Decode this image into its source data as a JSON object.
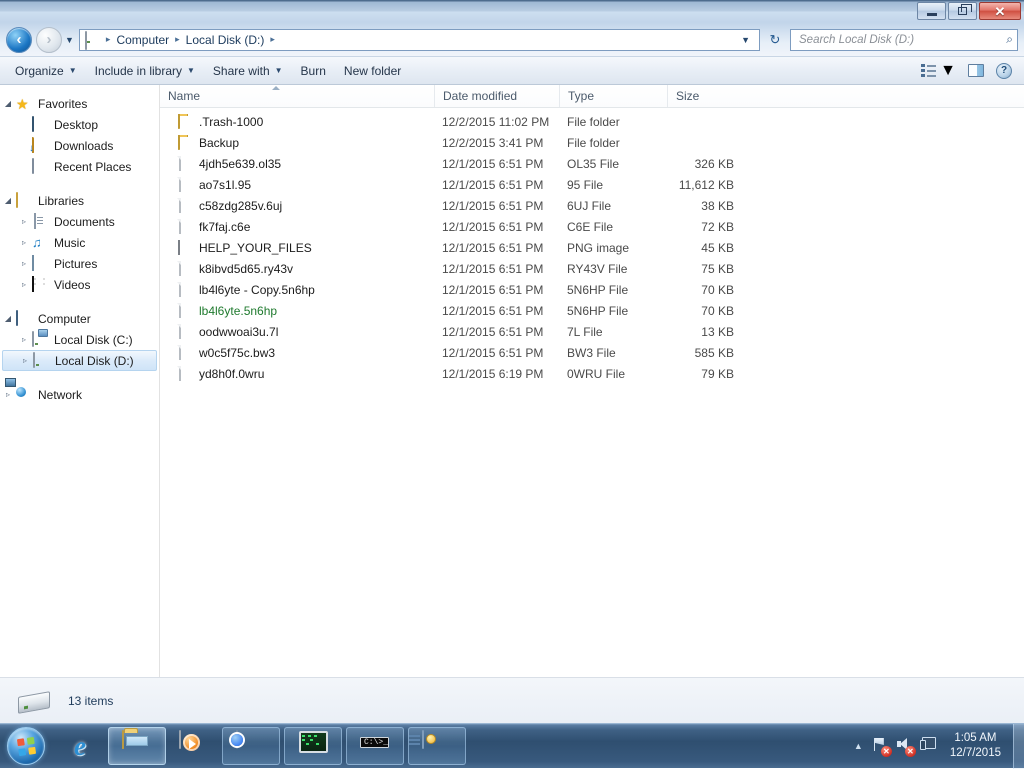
{
  "window": {
    "minimize_label": "Minimize",
    "restore_label": "Restore",
    "close_label": "Close"
  },
  "address_bar": {
    "back_label": "Back",
    "forward_label": "Forward",
    "history_label": "Recent pages",
    "crumbs": [
      "Computer",
      "Local Disk (D:)"
    ],
    "separator": "▸",
    "dropdown": "▼",
    "refresh_label": "Refresh",
    "refresh_icon": "↻"
  },
  "search": {
    "placeholder": "Search Local Disk (D:)",
    "icon": "⌕"
  },
  "toolbar": {
    "items": [
      {
        "label": "Organize",
        "caret": "▼"
      },
      {
        "label": "Include in library",
        "caret": "▼"
      },
      {
        "label": "Share with",
        "caret": "▼"
      },
      {
        "label": "Burn",
        "caret": ""
      },
      {
        "label": "New folder",
        "caret": ""
      }
    ],
    "view_caret": "▼",
    "view_label": "Change your view",
    "preview_label": "Show the preview pane",
    "help_label": "Get help",
    "help_glyph": "?"
  },
  "sidebar": {
    "groups": [
      {
        "header": {
          "label": "Favorites",
          "icon": "star-icon",
          "expander": "◢"
        },
        "items": [
          {
            "label": "Desktop",
            "icon": "desktop-icon",
            "expander": ""
          },
          {
            "label": "Downloads",
            "icon": "downloads-icon",
            "expander": ""
          },
          {
            "label": "Recent Places",
            "icon": "recent-places-icon",
            "expander": ""
          }
        ]
      },
      {
        "header": {
          "label": "Libraries",
          "icon": "libraries-icon",
          "expander": "◢"
        },
        "items": [
          {
            "label": "Documents",
            "icon": "documents-icon",
            "expander": "▹"
          },
          {
            "label": "Music",
            "icon": "music-icon",
            "expander": "▹"
          },
          {
            "label": "Pictures",
            "icon": "pictures-icon",
            "expander": "▹"
          },
          {
            "label": "Videos",
            "icon": "videos-icon",
            "expander": "▹"
          }
        ]
      },
      {
        "header": {
          "label": "Computer",
          "icon": "computer-icon",
          "expander": "◢"
        },
        "items": [
          {
            "label": "Local Disk (C:)",
            "icon": "system-drive-icon",
            "expander": "▹",
            "selected": false
          },
          {
            "label": "Local Disk (D:)",
            "icon": "drive-icon",
            "expander": "▹",
            "selected": true
          }
        ]
      },
      {
        "header": {
          "label": "Network",
          "icon": "network-icon",
          "expander": "▹"
        },
        "items": []
      }
    ]
  },
  "file_list": {
    "columns": [
      {
        "label": "Name",
        "sorted": "asc"
      },
      {
        "label": "Date modified",
        "sorted": ""
      },
      {
        "label": "Type",
        "sorted": ""
      },
      {
        "label": "Size",
        "sorted": ""
      }
    ],
    "rows": [
      {
        "name": ".Trash-1000",
        "date": "12/2/2015 11:02 PM",
        "type": "File folder",
        "size": "",
        "icon": "folder-icon",
        "color": "normal"
      },
      {
        "name": "Backup",
        "date": "12/2/2015 3:41 PM",
        "type": "File folder",
        "size": "",
        "icon": "folder-icon",
        "color": "normal"
      },
      {
        "name": "4jdh5e639.ol35",
        "date": "12/1/2015 6:51 PM",
        "type": "OL35 File",
        "size": "326 KB",
        "icon": "file-icon",
        "color": "normal"
      },
      {
        "name": "ao7s1l.95",
        "date": "12/1/2015 6:51 PM",
        "type": "95 File",
        "size": "11,612 KB",
        "icon": "file-icon",
        "color": "normal"
      },
      {
        "name": "c58zdg285v.6uj",
        "date": "12/1/2015 6:51 PM",
        "type": "6UJ File",
        "size": "38 KB",
        "icon": "file-icon",
        "color": "normal"
      },
      {
        "name": "fk7faj.c6e",
        "date": "12/1/2015 6:51 PM",
        "type": "C6E File",
        "size": "72 KB",
        "icon": "file-icon",
        "color": "normal"
      },
      {
        "name": "HELP_YOUR_FILES",
        "date": "12/1/2015 6:51 PM",
        "type": "PNG image",
        "size": "45 KB",
        "icon": "png-image-icon",
        "color": "normal"
      },
      {
        "name": "k8ibvd5d65.ry43v",
        "date": "12/1/2015 6:51 PM",
        "type": "RY43V File",
        "size": "75 KB",
        "icon": "file-icon",
        "color": "normal"
      },
      {
        "name": "lb4l6yte - Copy.5n6hp",
        "date": "12/1/2015 6:51 PM",
        "type": "5N6HP File",
        "size": "70 KB",
        "icon": "file-icon",
        "color": "normal"
      },
      {
        "name": "lb4l6yte.5n6hp",
        "date": "12/1/2015 6:51 PM",
        "type": "5N6HP File",
        "size": "70 KB",
        "icon": "file-icon",
        "color": "green"
      },
      {
        "name": "oodwwoai3u.7l",
        "date": "12/1/2015 6:51 PM",
        "type": "7L File",
        "size": "13 KB",
        "icon": "file-icon",
        "color": "normal"
      },
      {
        "name": "w0c5f75c.bw3",
        "date": "12/1/2015 6:51 PM",
        "type": "BW3 File",
        "size": "585 KB",
        "icon": "file-icon",
        "color": "normal"
      },
      {
        "name": "yd8h0f.0wru",
        "date": "12/1/2015 6:19 PM",
        "type": "0WRU File",
        "size": "79 KB",
        "icon": "file-icon",
        "color": "normal"
      }
    ]
  },
  "status_bar": {
    "item_count": "13 items",
    "drive_icon": "drive-icon"
  },
  "taskbar": {
    "start_label": "Start",
    "buttons": [
      {
        "name": "internet-explorer",
        "label": "Internet Explorer",
        "state": "pinned"
      },
      {
        "name": "windows-explorer",
        "label": "Windows Explorer",
        "state": "active"
      },
      {
        "name": "windows-media-player",
        "label": "Windows Media Player",
        "state": "pinned"
      },
      {
        "name": "google-chrome",
        "label": "Google Chrome",
        "state": "open"
      },
      {
        "name": "system-monitor",
        "label": "System Monitor",
        "state": "open"
      },
      {
        "name": "command-prompt",
        "label": "Command Prompt",
        "state": "open"
      },
      {
        "name": "control-panel",
        "label": "Control Panel",
        "state": "open"
      }
    ],
    "cmd_prompt_text": "C:\\>_",
    "tray": {
      "overflow_arrow": "▲",
      "network_label": "Network - no connection",
      "volume_label": "Volume - muted",
      "action_center_label": "Action Center",
      "error_badge": "✕"
    },
    "clock": {
      "time": "1:05 AM",
      "date": "12/7/2015"
    },
    "show_desktop_label": "Show desktop"
  },
  "colors": {
    "accent": "#2c5b92",
    "titlebar_top": "#4e6c8e",
    "close_red": "#cf4f41",
    "green_file": "#1f7a2e",
    "selection_blue": "#cfe4f8"
  }
}
